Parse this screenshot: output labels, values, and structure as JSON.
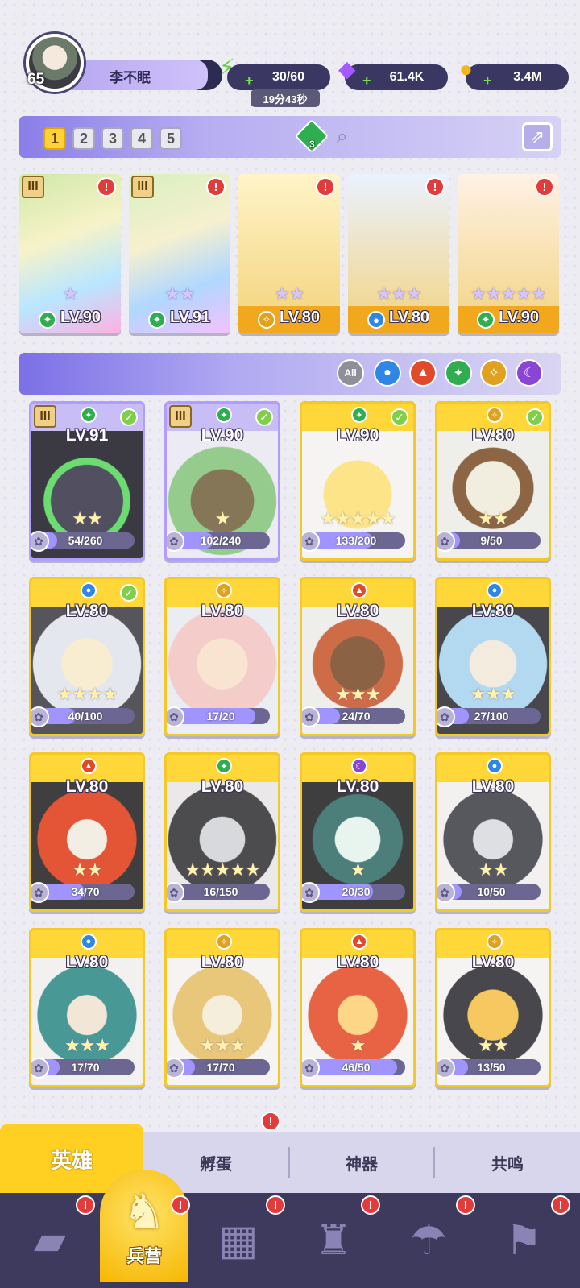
{
  "player": {
    "level": "65",
    "name": "李不眠"
  },
  "resources": {
    "energy": {
      "value": "30/60",
      "timer": "19分43秒",
      "icon": "lightning-icon",
      "color": "#5ed43a"
    },
    "gems": {
      "value": "61.4K",
      "icon": "purple-gem-icon",
      "color": "#a35bff"
    },
    "coins": {
      "value": "3.4M",
      "icon": "gold-coin-icon",
      "color": "#f3b51c"
    }
  },
  "team_tabs": [
    "1",
    "2",
    "3",
    "4",
    "5"
  ],
  "team_tab_selected": "1",
  "team_power_badge": "3",
  "team": [
    {
      "level": "LV.90",
      "stars": "★",
      "element": "wind",
      "rank_badge": "III",
      "alert": "!"
    },
    {
      "level": "LV.91",
      "stars": "★★",
      "element": "wind",
      "rank_badge": "III",
      "alert": "!"
    },
    {
      "level": "LV.80",
      "stars": "★★",
      "element": "light",
      "alert": "!"
    },
    {
      "level": "LV.80",
      "stars": "★★★",
      "element": "water",
      "alert": "!"
    },
    {
      "level": "LV.90",
      "stars": "★★★★★",
      "element": "wind",
      "alert": "!"
    }
  ],
  "filters": [
    {
      "label": "All",
      "icon": "all-filter-icon",
      "color": "#8f8f99"
    },
    {
      "label": "",
      "icon": "water-element-icon",
      "color": "#2e86e6"
    },
    {
      "label": "",
      "icon": "fire-element-icon",
      "color": "#e04a2a"
    },
    {
      "label": "",
      "icon": "wind-element-icon",
      "color": "#2fae4f"
    },
    {
      "label": "",
      "icon": "light-element-icon",
      "color": "#e0a020"
    },
    {
      "label": "",
      "icon": "dark-element-icon",
      "color": "#8a44d6"
    }
  ],
  "heroes": [
    {
      "level": "LV.91",
      "stars": "★★",
      "fragments": "54/260",
      "progress": 0.21,
      "element": "wind",
      "rank_badge": "III",
      "checked": true,
      "rarity": "purple"
    },
    {
      "level": "LV.90",
      "stars": "★",
      "fragments": "102/240",
      "progress": 0.43,
      "element": "wind",
      "rank_badge": "III",
      "checked": true,
      "rarity": "purple"
    },
    {
      "level": "LV.90",
      "stars": "★★★★★",
      "fragments": "133/200",
      "progress": 0.67,
      "element": "wind",
      "checked": true,
      "rarity": "gold"
    },
    {
      "level": "LV.80",
      "stars": "★★",
      "fragments": "9/50",
      "progress": 0.18,
      "element": "light",
      "checked": true,
      "rarity": "gold"
    },
    {
      "level": "LV.80",
      "stars": "★★★★",
      "fragments": "40/100",
      "progress": 0.4,
      "element": "water",
      "checked": true,
      "rarity": "gold"
    },
    {
      "level": "LV.80",
      "stars": "",
      "fragments": "17/20",
      "progress": 0.85,
      "element": "light",
      "checked": false,
      "rarity": "gold"
    },
    {
      "level": "LV.80",
      "stars": "★★★",
      "fragments": "24/70",
      "progress": 0.34,
      "element": "fire",
      "checked": false,
      "rarity": "gold"
    },
    {
      "level": "LV.80",
      "stars": "★★★",
      "fragments": "27/100",
      "progress": 0.27,
      "element": "water",
      "checked": false,
      "rarity": "gold"
    },
    {
      "level": "LV.80",
      "stars": "★★",
      "fragments": "34/70",
      "progress": 0.49,
      "element": "fire",
      "checked": false,
      "rarity": "gold"
    },
    {
      "level": "LV.80",
      "stars": "★★★★★",
      "fragments": "16/150",
      "progress": 0.11,
      "element": "wind",
      "checked": false,
      "rarity": "gold"
    },
    {
      "level": "LV.80",
      "stars": "★",
      "fragments": "20/30",
      "progress": 0.67,
      "element": "dark",
      "checked": false,
      "rarity": "gold"
    },
    {
      "level": "LV.80",
      "stars": "★★",
      "fragments": "10/50",
      "progress": 0.2,
      "element": "water",
      "checked": false,
      "rarity": "gold"
    },
    {
      "level": "LV.80",
      "stars": "★★★",
      "fragments": "17/70",
      "progress": 0.24,
      "element": "water",
      "checked": false,
      "rarity": "gold"
    },
    {
      "level": "LV.80",
      "stars": "★★★",
      "fragments": "17/70",
      "progress": 0.24,
      "element": "light",
      "checked": false,
      "rarity": "gold"
    },
    {
      "level": "LV.80",
      "stars": "★",
      "fragments": "46/50",
      "progress": 0.92,
      "element": "fire",
      "checked": false,
      "rarity": "gold"
    },
    {
      "level": "LV.80",
      "stars": "★★",
      "fragments": "13/50",
      "progress": 0.26,
      "element": "light",
      "checked": false,
      "rarity": "gold"
    }
  ],
  "subtabs": [
    {
      "label": "英雄",
      "active": true,
      "alert": ""
    },
    {
      "label": "孵蛋",
      "active": false,
      "alert": "!"
    },
    {
      "label": "神器",
      "active": false,
      "alert": ""
    },
    {
      "label": "共鸣",
      "active": false,
      "alert": ""
    }
  ],
  "navbar": [
    {
      "icon": "cards-icon",
      "label": "",
      "alert": "!"
    },
    {
      "icon": "barracks-icon",
      "label": "兵营",
      "alert": "!",
      "active": true
    },
    {
      "icon": "map-book-icon",
      "label": "",
      "alert": "!"
    },
    {
      "icon": "castle-icon",
      "label": "",
      "alert": "!"
    },
    {
      "icon": "mushroom-shop-icon",
      "label": "",
      "alert": "!"
    },
    {
      "icon": "banner-icon",
      "label": "",
      "alert": "!"
    }
  ]
}
